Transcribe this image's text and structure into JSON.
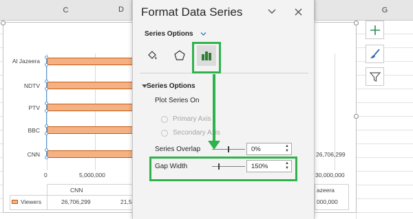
{
  "sheet": {
    "columns": [
      "C",
      "D",
      "G"
    ]
  },
  "chart": {
    "categories": [
      "Al Jazeera",
      "NDTV",
      "PTV",
      "BBC",
      "CNN"
    ],
    "x_ticks": [
      "0",
      "5,000,000",
      "30,000,000"
    ],
    "visible_value_label": "26,706,299",
    "table_headers": [
      "CNN",
      "azeera"
    ],
    "table_series_name": "Viewers",
    "table_values": [
      "26,706,299",
      "21,5",
      "000,000"
    ],
    "colors": {
      "bar_fill": "#f4b183",
      "bar_border": "#c55a11",
      "selection": "#5b9bd5"
    }
  },
  "chart_data": {
    "type": "bar",
    "categories": [
      "CNN",
      "BBC",
      "PTV",
      "NDTV",
      "Al Jazeera"
    ],
    "series": [
      {
        "name": "Viewers",
        "values": [
          26706299,
          null,
          null,
          null,
          null
        ]
      }
    ],
    "xlabel": "",
    "ylabel": "",
    "x_ticks_visible": [
      "0",
      "5,000,000",
      "30,000,000"
    ]
  },
  "side_buttons": [
    {
      "icon": "plus-icon"
    },
    {
      "icon": "brush-icon"
    },
    {
      "icon": "filter-icon"
    }
  ],
  "pane": {
    "title": "Format Data Series",
    "series_options_dropdown": "Series Options",
    "section_title": "Series Options",
    "plot_series_on": "Plot Series On",
    "primary_axis": "Primary Axis",
    "secondary_axis": "Secondary Axis",
    "series_overlap_label": "Series Overlap",
    "series_overlap_value": "0%",
    "gap_width_label": "Gap Width",
    "gap_width_value": "150%",
    "annotation_color": "#2fb24c"
  }
}
